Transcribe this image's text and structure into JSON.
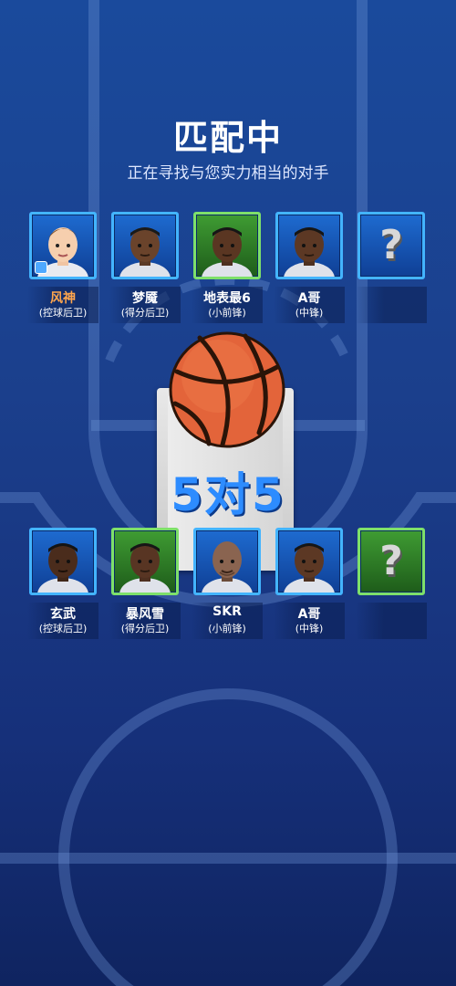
{
  "header": {
    "title": "匹配中",
    "subtitle": "正在寻找与您实力相当的对手"
  },
  "versus": {
    "label": "5对5"
  },
  "team_top": [
    {
      "name": "风神",
      "position": "(控球后卫)",
      "self": true,
      "bg": "blue",
      "skin": "light"
    },
    {
      "name": "梦魇",
      "position": "(得分后卫)",
      "bg": "blue",
      "skin": "dark"
    },
    {
      "name": "地表最6",
      "position": "(小前锋)",
      "bg": "green",
      "skin": "dark"
    },
    {
      "name": "A哥",
      "position": "(中锋)",
      "bg": "blue",
      "skin": "dark"
    },
    {
      "name": "",
      "position": "",
      "empty": true,
      "bg": "blue"
    }
  ],
  "team_bottom": [
    {
      "name": "玄武",
      "position": "(控球后卫)",
      "bg": "blue",
      "skin": "dark"
    },
    {
      "name": "暴风雪",
      "position": "(得分后卫)",
      "bg": "green",
      "skin": "dark"
    },
    {
      "name": "SKR",
      "position": "(小前锋)",
      "bg": "blue",
      "skin": "bald"
    },
    {
      "name": "A哥",
      "position": "(中锋)",
      "bg": "blue",
      "skin": "dark"
    },
    {
      "name": "",
      "position": "",
      "empty": true,
      "bg": "green"
    }
  ],
  "empty_slot": {
    "symbol": "?"
  },
  "colors": {
    "accent_blue": "#43b4ff",
    "accent_green": "#7ee06a",
    "self_name": "#ffa64d",
    "vs_text": "#2d8cff"
  }
}
